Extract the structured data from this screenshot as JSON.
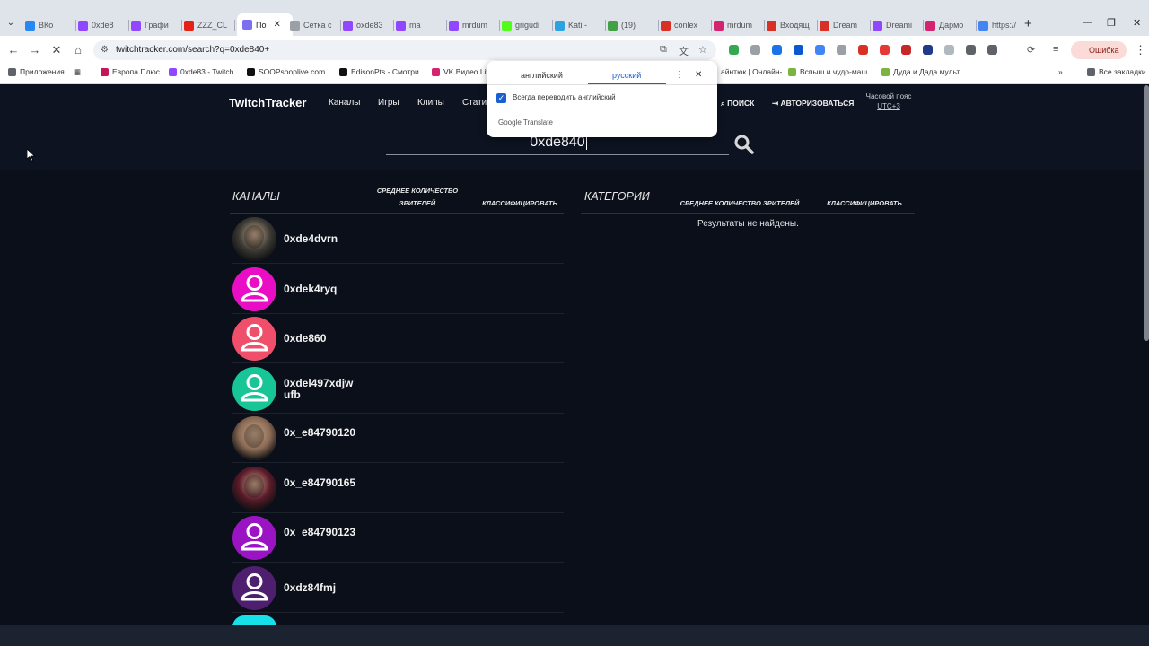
{
  "browser": {
    "tabs": [
      {
        "label": "ВКо",
        "color": "#2787f5"
      },
      {
        "label": "0xde8",
        "color": "#9146ff"
      },
      {
        "label": "Графи",
        "color": "#9146ff"
      },
      {
        "label": "ZZZ_CL",
        "color": "#e62117"
      },
      {
        "label": "По",
        "color": "#7c6ff0",
        "active": true
      },
      {
        "label": "Сетка с",
        "color": "#9aa0a6"
      },
      {
        "label": "oxde83",
        "color": "#9146ff"
      },
      {
        "label": "ma",
        "color": "#9146ff"
      },
      {
        "label": "mrdum",
        "color": "#9146ff"
      },
      {
        "label": "grigudi",
        "color": "#53fc18"
      },
      {
        "label": "Kati -",
        "color": "#2aa3e0"
      },
      {
        "label": "(19)",
        "color": "#43a047"
      },
      {
        "label": "conlex",
        "color": "#d93025"
      },
      {
        "label": "mrdum",
        "color": "#d4246f"
      },
      {
        "label": "Входящ",
        "color": "#d93025"
      },
      {
        "label": "Dream",
        "color": "#d93025"
      },
      {
        "label": "Dreami",
        "color": "#9146ff"
      },
      {
        "label": "Дармо",
        "color": "#d4246f"
      },
      {
        "label": "https://",
        "color": "#4285f4"
      }
    ],
    "url": "twitchtracker.com/search?q=0xde840+",
    "error_label": "Ошибка",
    "bookmarks": [
      {
        "label": "Приложения",
        "color": "#5f6368"
      },
      {
        "label": "Европа Плюс",
        "color": "#c2185b"
      },
      {
        "label": "0xde83 - Twitch",
        "color": "#9146ff"
      },
      {
        "label": "SOOPsooplive.com...",
        "color": "#111111"
      },
      {
        "label": "EdisonPts - Смотри...",
        "color": "#111111"
      },
      {
        "label": "VK Видео Liv",
        "color": "#d4246f"
      },
      {
        "label": "айнтюк | Онлайн-...",
        "color": "#ffffff"
      },
      {
        "label": "Вспыш и чудо-маш...",
        "color": "#7cb342"
      },
      {
        "label": "Дуда и Дада мульт...",
        "color": "#7cb342"
      },
      {
        "label": "Все закладки",
        "color": "#5f6368"
      }
    ]
  },
  "translate_popup": {
    "source_lang": "английский",
    "target_lang": "русский",
    "always_translate": "Всегда переводить английский",
    "footer": "Google Translate"
  },
  "site": {
    "brand": "TwitchTracker",
    "nav": [
      "Каналы",
      "Игры",
      "Клипы",
      "Стати"
    ],
    "search_link": "ПОИСК",
    "login_link": "АВТОРИЗОВАТЬСЯ",
    "timezone_label": "Часовой пояс",
    "timezone_value": "UTC+3",
    "search_query": "0xde840"
  },
  "channels_panel": {
    "title": "КАНАЛЫ",
    "col_avg_viewers_1": "СРЕДНЕЕ КОЛИЧЕСТВО",
    "col_avg_viewers_2": "ЗРИТЕЛЕЙ",
    "col_rank": "КЛАССИФИЦИРОВАТЬ",
    "items": [
      {
        "name": "0xde4dvrn",
        "avatar": "photo",
        "color": "#3b3a35"
      },
      {
        "name": "0xdek4ryq",
        "avatar": "default",
        "color": "#e90ec5"
      },
      {
        "name": "0xde860",
        "avatar": "default",
        "color": "#ef4f6a"
      },
      {
        "name": "0xdel497xdjwufb",
        "avatar": "default",
        "color": "#17c596"
      },
      {
        "name": "0x_e84790120",
        "avatar": "photo",
        "color": "#8a6a55"
      },
      {
        "name": "0x_e84790165",
        "avatar": "photo",
        "color": "#5a1a2a"
      },
      {
        "name": "0x_e84790123",
        "avatar": "default",
        "color": "#9b14c4"
      },
      {
        "name": "0xdz84fmj",
        "avatar": "default",
        "color": "#4d1f6e"
      }
    ]
  },
  "categories_panel": {
    "title": "КАТЕГОРИИ",
    "col_avg_viewers": "СРЕДНЕЕ КОЛИЧЕСТВО ЗРИТЕЛЕЙ",
    "col_rank": "КЛАССИФИЦИРОВАТЬ",
    "empty_message": "Результаты не найдены."
  }
}
